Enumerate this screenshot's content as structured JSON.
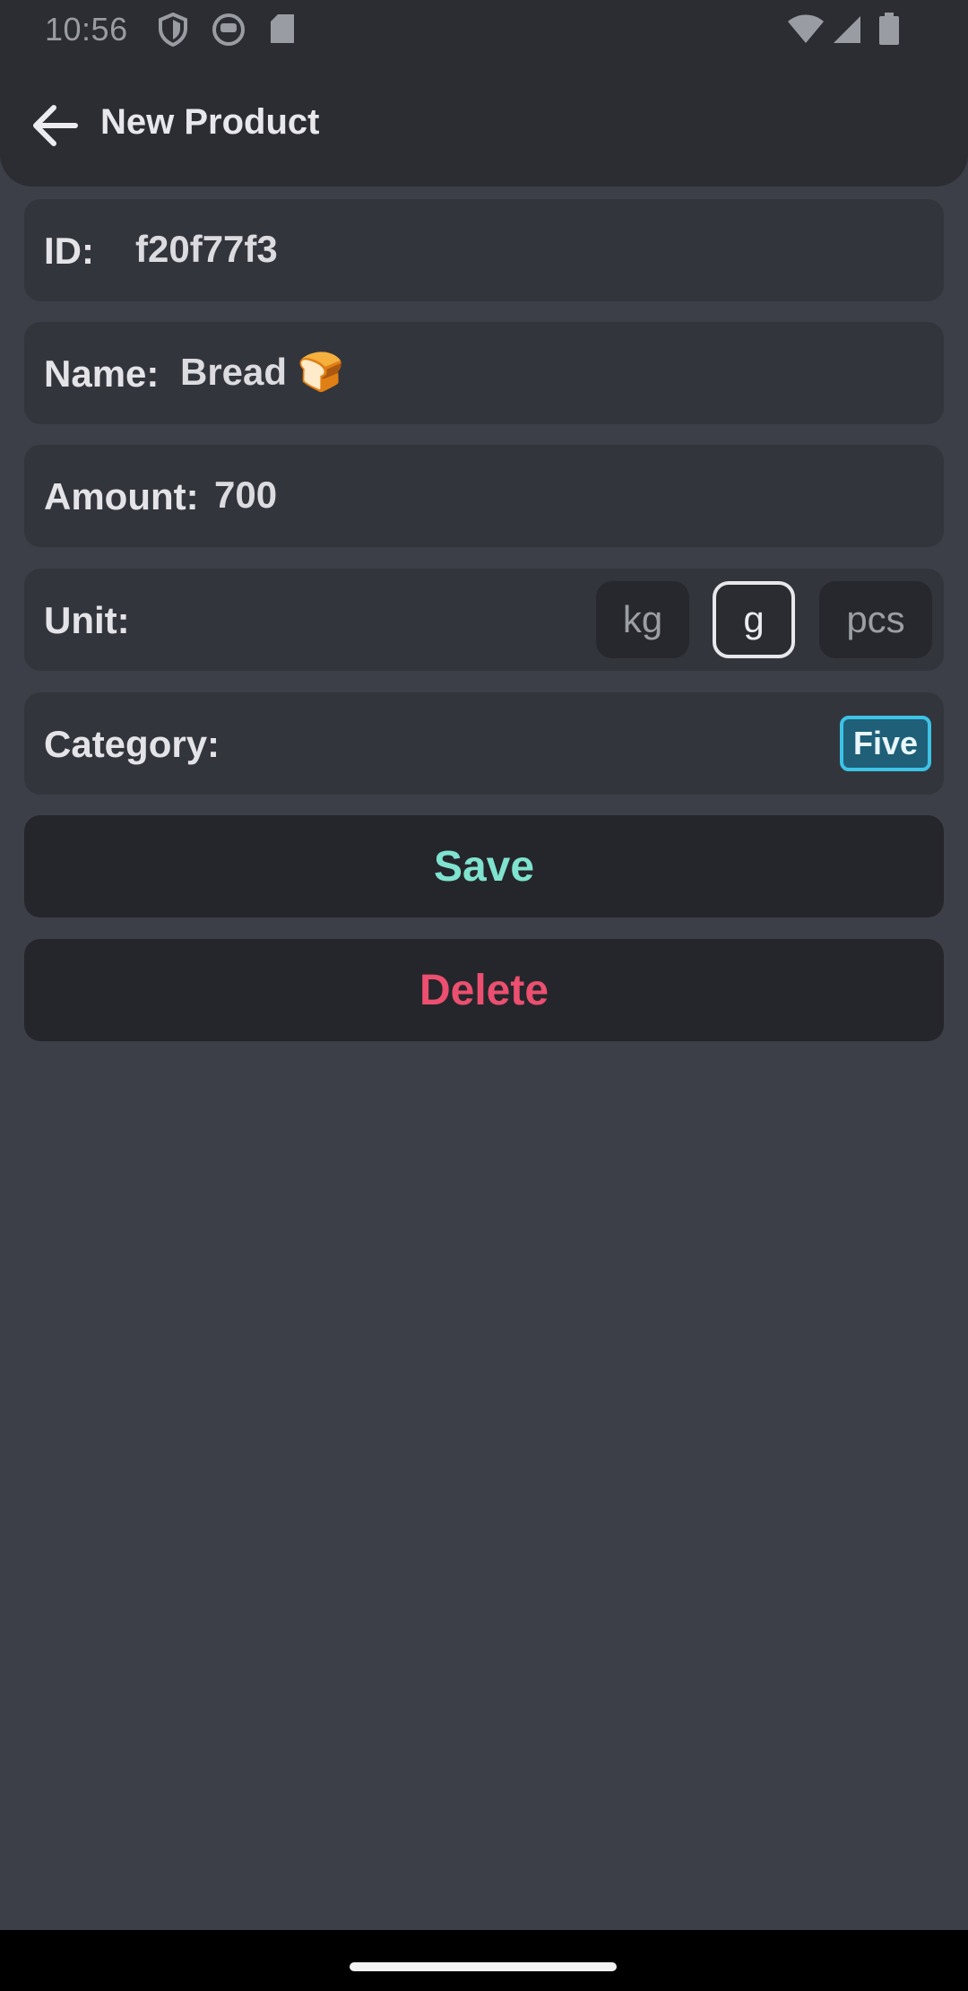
{
  "status_bar": {
    "time": "10:56",
    "icons": [
      "shield-icon",
      "app-icon",
      "sd-card-icon",
      "wifi-icon",
      "signal-icon",
      "battery-icon"
    ]
  },
  "app_bar": {
    "back_icon": "arrow-left-icon",
    "title": "New Product"
  },
  "form": {
    "id": {
      "label": "ID:",
      "value": "f20f77f3"
    },
    "name": {
      "label": "Name:",
      "value": "Bread 🍞"
    },
    "amount": {
      "label": "Amount:",
      "value": "700"
    },
    "unit": {
      "label": "Unit:",
      "options": [
        "kg",
        "g",
        "pcs"
      ],
      "selected": "g"
    },
    "category": {
      "label": "Category:",
      "value": "Five"
    }
  },
  "actions": {
    "save_label": "Save",
    "delete_label": "Delete"
  },
  "colors": {
    "background": "#3c3f48",
    "save_text": "#7fe3cf",
    "delete_text": "#ec4f6f",
    "category_accent": "#3cc3e6"
  }
}
